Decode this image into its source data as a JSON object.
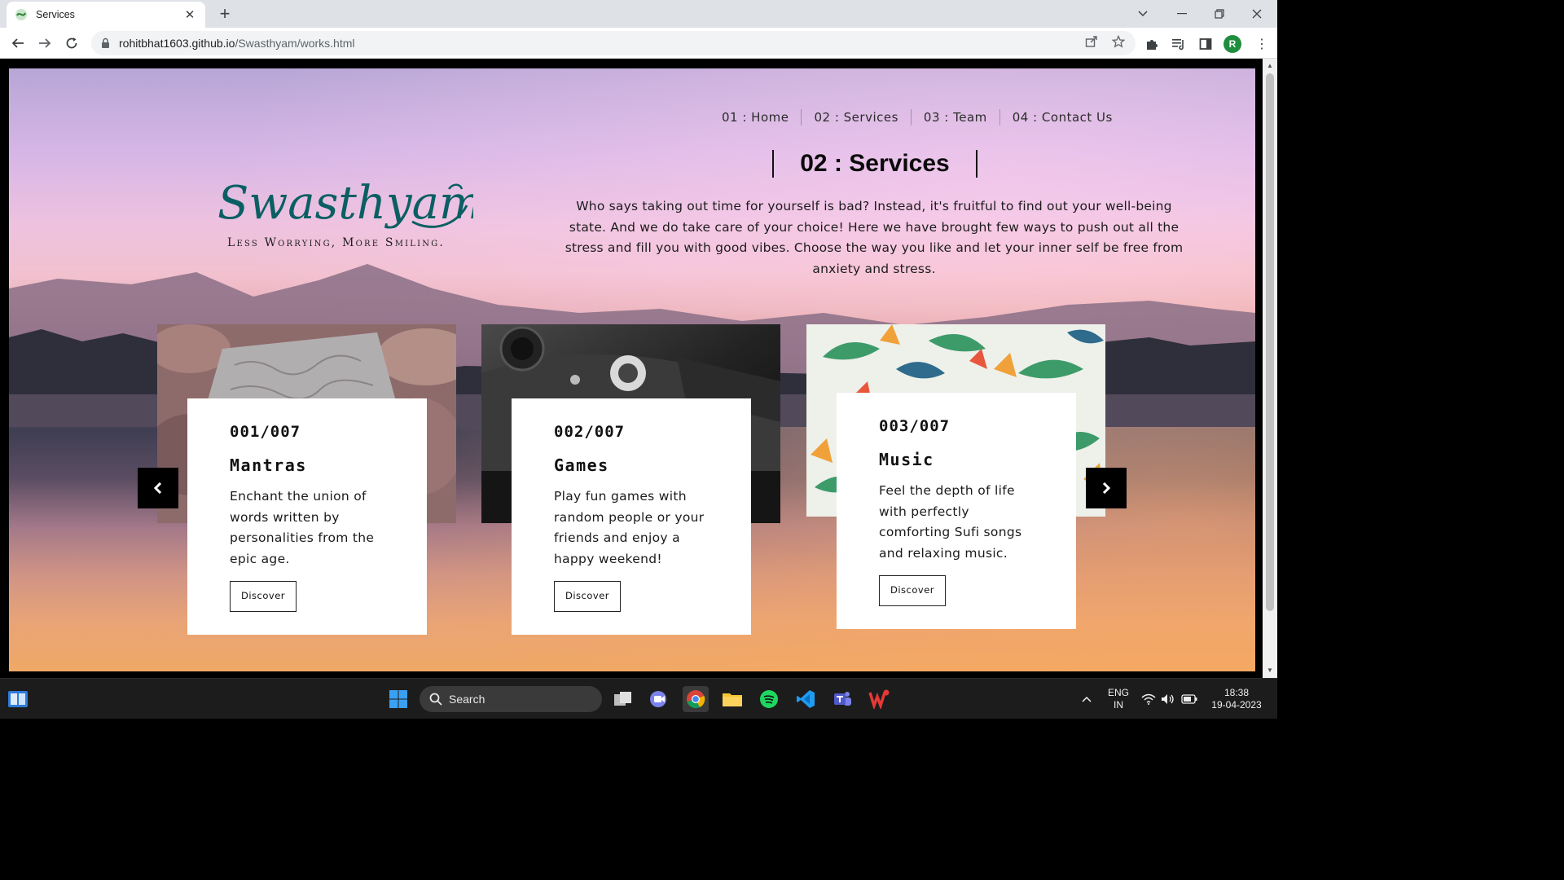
{
  "browser": {
    "tab_title": "Services",
    "url_host": "rohitbhat1603.github.io",
    "url_path": "/Swasthyam/works.html",
    "profile_initial": "R"
  },
  "site": {
    "nav": [
      "01 : Home",
      "02 : Services",
      "03 : Team",
      "04 : Contact Us"
    ],
    "logo_text": "Swasthyam",
    "tagline": "Less Worrying, More Smiling.",
    "section_title": "02 : Services",
    "intro": "Who says taking out time for yourself is bad? Instead, it's fruitful to find out your well-being state. And we do take care of your choice! Here we have brought few ways to push out all the stress and fill you with good vibes. Choose the way you like and let your inner self be free from anxiety and stress.",
    "cards": [
      {
        "num": "001/007",
        "name": "Mantras",
        "desc": "Enchant the union of words written by personalities from the epic age.",
        "button": "Discover"
      },
      {
        "num": "002/007",
        "name": "Games",
        "desc": "Play fun games with random people or your friends and enjoy a happy weekend!",
        "button": "Discover"
      },
      {
        "num": "003/007",
        "name": "Music",
        "desc": "Feel the depth of life with perfectly comforting Sufi songs and relaxing music.",
        "button": "Discover"
      }
    ]
  },
  "taskbar": {
    "search_label": "Search",
    "lang_1": "ENG",
    "lang_2": "IN",
    "time": "18:38",
    "date": "19-04-2023"
  },
  "colors": {
    "logo_teal": "#0b5f63",
    "accent_black": "#000000"
  }
}
